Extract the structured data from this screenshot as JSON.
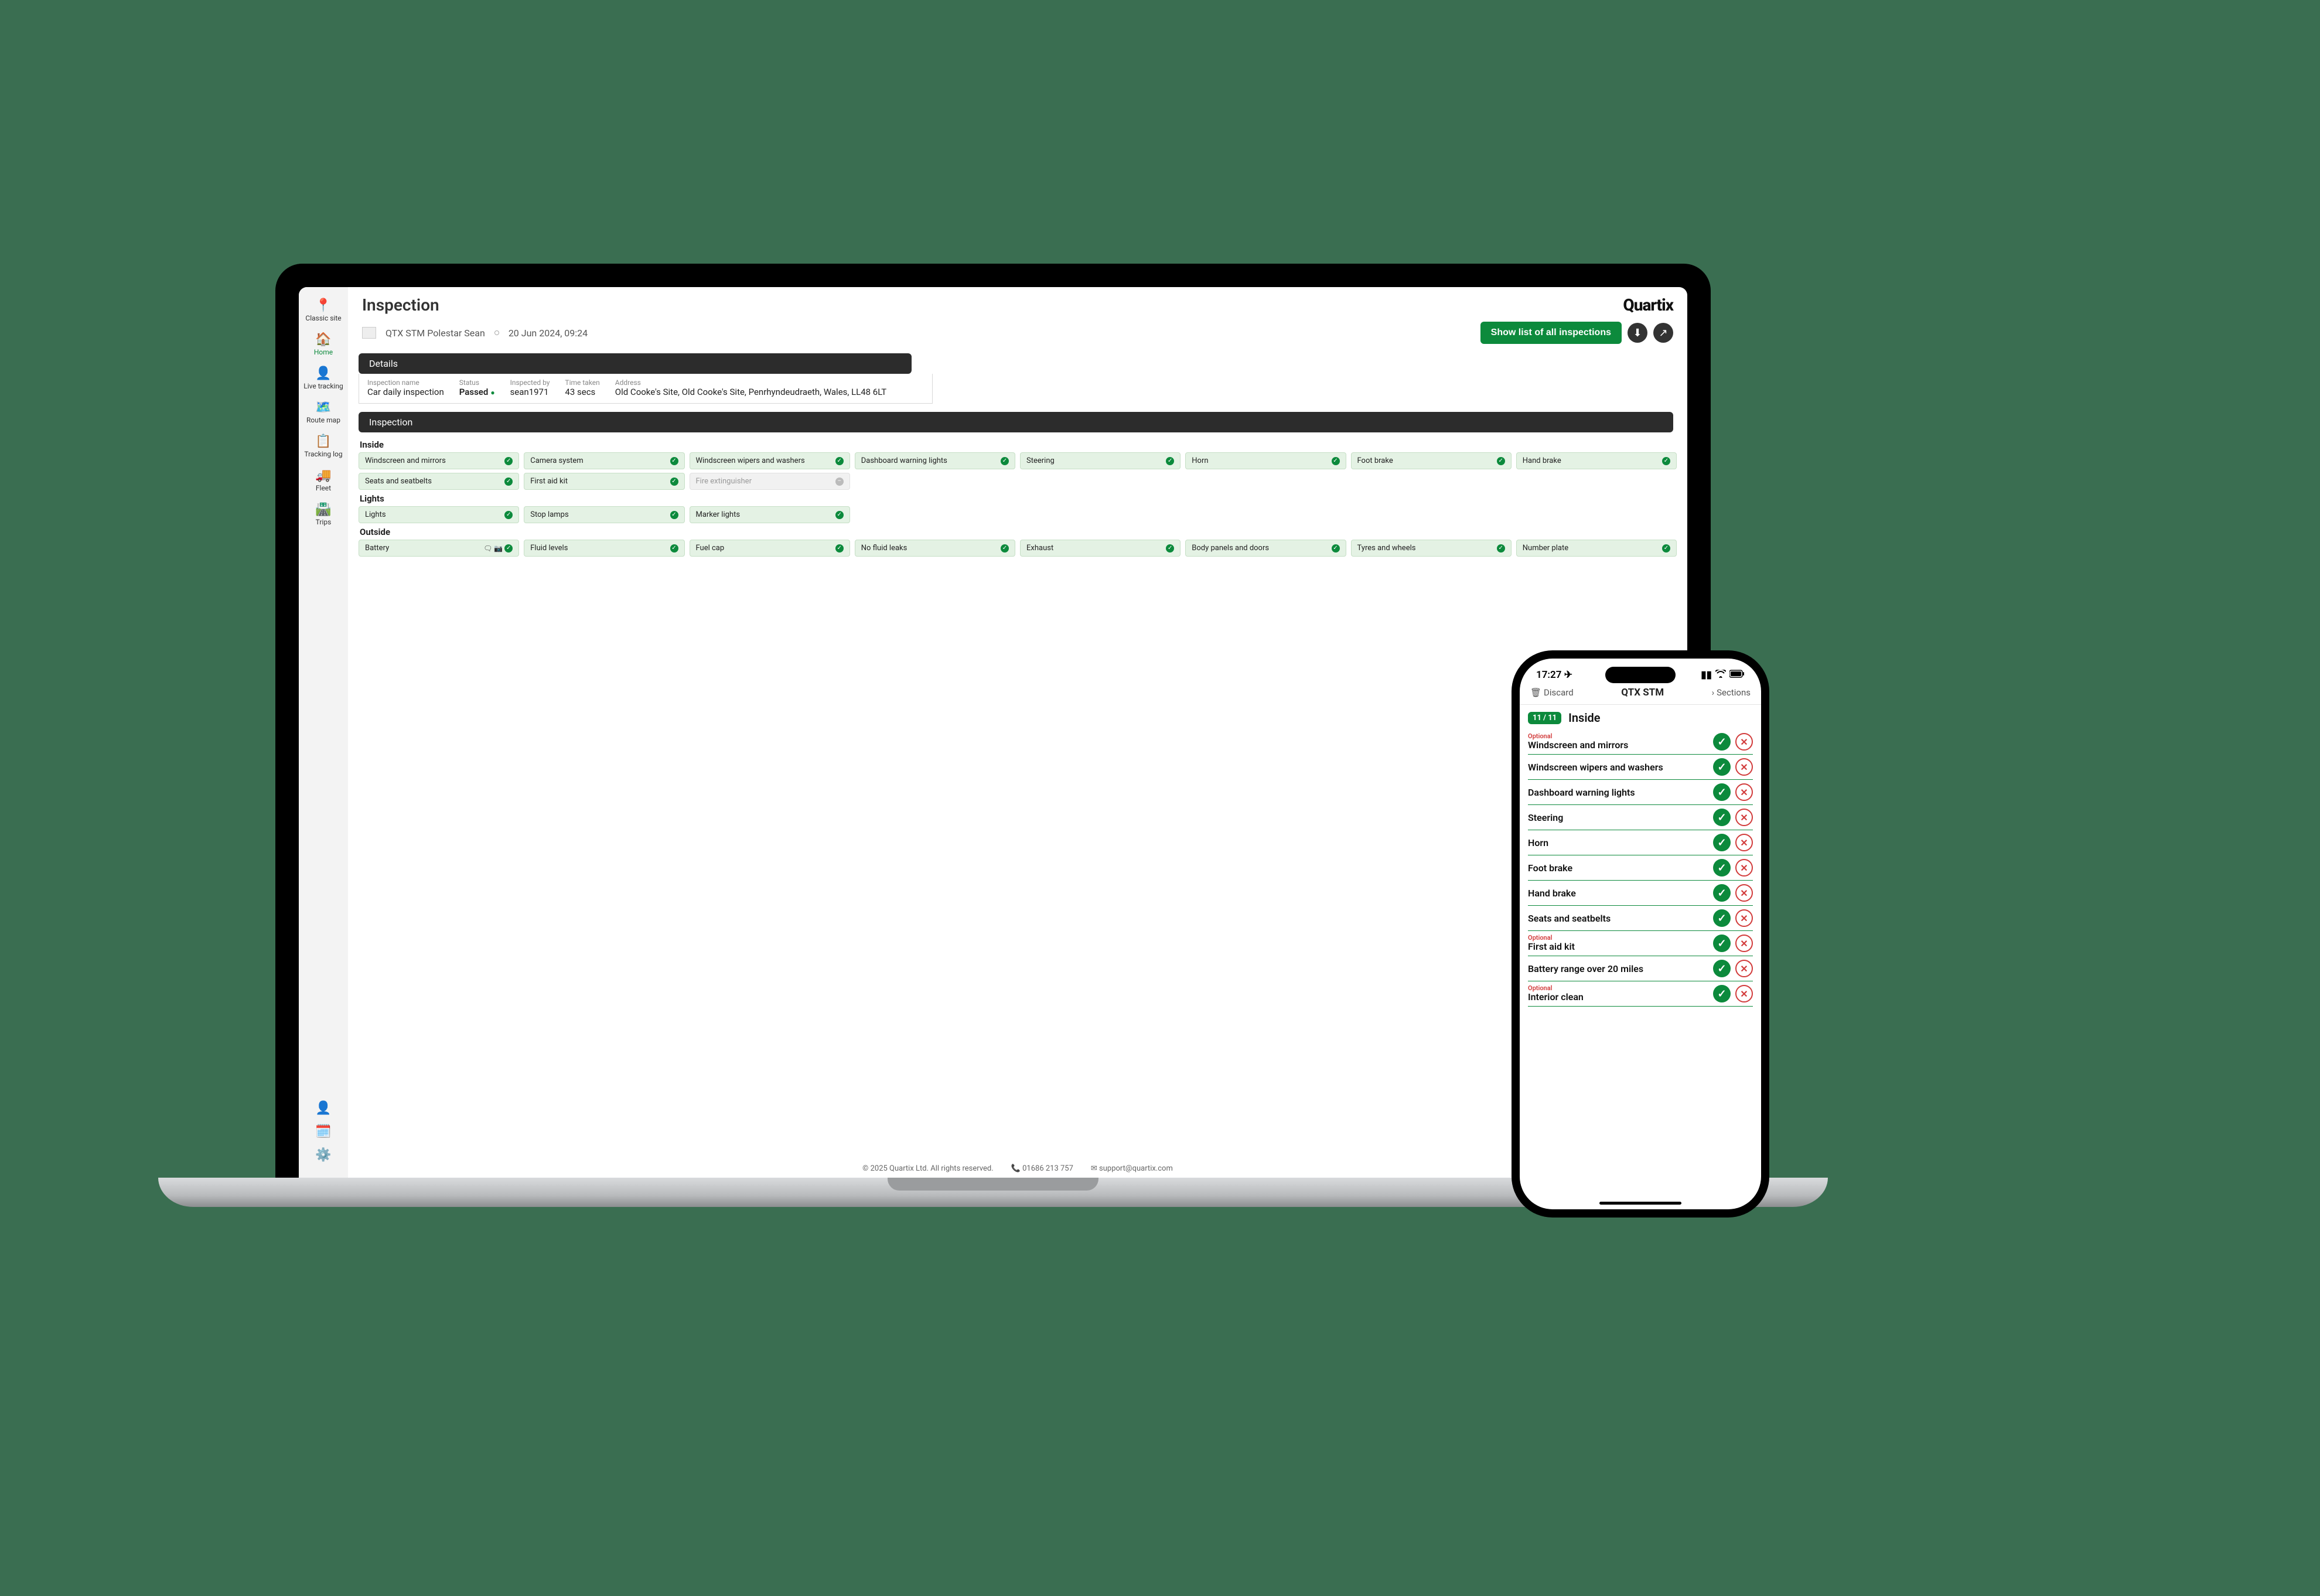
{
  "brand": "Quartix",
  "page_title": "Inspection",
  "vehicle": "QTX STM Polestar Sean",
  "datetime": "20 Jun 2024, 09:24",
  "action_button": "Show list of all inspections",
  "sidebar": {
    "items": [
      {
        "label": "Classic site"
      },
      {
        "label": "Home"
      },
      {
        "label": "Live tracking"
      },
      {
        "label": "Route map"
      },
      {
        "label": "Tracking log"
      },
      {
        "label": "Fleet"
      },
      {
        "label": "Trips"
      }
    ]
  },
  "panels": {
    "details_title": "Details",
    "inspection_title": "Inspection"
  },
  "details": {
    "cols": [
      {
        "lbl": "Inspection name",
        "val": "Car daily inspection"
      },
      {
        "lbl": "Status",
        "val": "Passed"
      },
      {
        "lbl": "Inspected by",
        "val": "sean1971"
      },
      {
        "lbl": "Time taken",
        "val": "43 secs"
      },
      {
        "lbl": "Address",
        "val": "Old Cooke's Site, Old Cooke's Site, Penrhyndeudraeth, Wales, LL48 6LT"
      }
    ]
  },
  "sections": {
    "inside": {
      "title": "Inside",
      "row1": [
        "Windscreen and mirrors",
        "Camera system",
        "Windscreen wipers and washers",
        "Dashboard warning lights",
        "Steering",
        "Horn",
        "Foot brake",
        "Hand brake"
      ],
      "row2": [
        "Seats and seatbelts",
        "First aid kit"
      ],
      "row2_grey": "Fire extinguisher"
    },
    "lights": {
      "title": "Lights",
      "items": [
        "Lights",
        "Stop lamps",
        "Marker lights"
      ]
    },
    "outside": {
      "title": "Outside",
      "first": "Battery",
      "rest": [
        "Fluid levels",
        "Fuel cap",
        "No fluid leaks",
        "Exhaust",
        "Body panels and doors",
        "Tyres and wheels",
        "Number plate"
      ]
    }
  },
  "footer": {
    "copyright": "© 2025 Quartix Ltd. All rights reserved.",
    "phone": "01686 213 757",
    "email": "support@quartix.com"
  },
  "phone": {
    "clock": "17:27",
    "discard": "Discard",
    "title": "QTX STM",
    "sections": "Sections",
    "count": "11 / 11",
    "sect_title": "Inside",
    "items": [
      {
        "label": "Windscreen and mirrors",
        "optional": true
      },
      {
        "label": "Windscreen wipers and washers",
        "optional": false
      },
      {
        "label": "Dashboard warning lights",
        "optional": false
      },
      {
        "label": "Steering",
        "optional": false
      },
      {
        "label": "Horn",
        "optional": false
      },
      {
        "label": "Foot brake",
        "optional": false
      },
      {
        "label": "Hand brake",
        "optional": false
      },
      {
        "label": "Seats and seatbelts",
        "optional": false
      },
      {
        "label": "First aid kit",
        "optional": true
      },
      {
        "label": "Battery range over 20 miles",
        "optional": false
      },
      {
        "label": "Interior clean",
        "optional": true
      }
    ],
    "optional_tag": "Optional"
  }
}
